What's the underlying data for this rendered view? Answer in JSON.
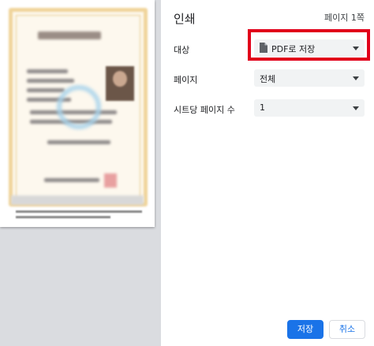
{
  "dialog": {
    "title": "인쇄",
    "page_count": "페이지 1쪽"
  },
  "destination": {
    "label": "대상",
    "value": "PDF로 저장",
    "icon": "file-icon"
  },
  "pages": {
    "label": "페이지",
    "value": "전체"
  },
  "pages_per_sheet": {
    "label": "시트당 페이지 수",
    "value": "1"
  },
  "buttons": {
    "save": "저장",
    "cancel": "취소"
  },
  "colors": {
    "primary": "#1a73e8",
    "highlight": "#e1001a",
    "select_bg": "#f1f3f4"
  }
}
